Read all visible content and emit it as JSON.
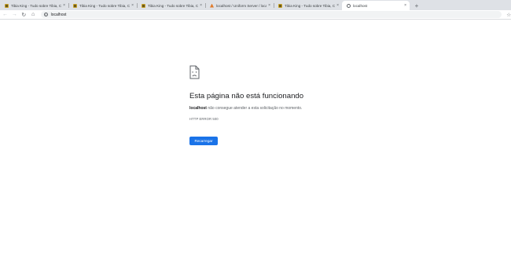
{
  "tabs": [
    {
      "title": "Tibia King - Tudo sobre Tibia, C",
      "favicon": "tibia-king-icon",
      "active": false
    },
    {
      "title": "Tibia King - Tudo sobre Tibia, C",
      "favicon": "tibia-king-icon",
      "active": false
    },
    {
      "title": "Tibia King - Tudo sobre Tibia, C",
      "favicon": "tibia-king-icon",
      "active": false
    },
    {
      "title": "localhost / Uniform Server / loca",
      "favicon": "uniform-server-icon",
      "active": false
    },
    {
      "title": "Tibia King - Tudo sobre Tibia, C",
      "favicon": "tibia-king-icon",
      "active": false
    },
    {
      "title": "localhost",
      "favicon": "globe-icon",
      "active": true
    }
  ],
  "tab_close_glyph": "×",
  "new_tab_glyph": "+",
  "toolbar": {
    "back_glyph": "←",
    "forward_glyph": "→",
    "reload_glyph": "↻",
    "home_glyph": "⌂",
    "url": "localhost",
    "bookmark_glyph": "☆",
    "info_glyph": "i"
  },
  "error": {
    "icon": "sad-page-icon",
    "title": "Esta página não está funcionando",
    "host": "localhost",
    "summary_rest": " não consegue atender a esta solicitação no momento.",
    "code": "HTTP ERROR 500",
    "reload_label": "Recarregar"
  },
  "colors": {
    "tabstrip": "#dee1e6",
    "button": "#1a73e8",
    "text_primary": "#202124",
    "text_secondary": "#5f6368"
  }
}
